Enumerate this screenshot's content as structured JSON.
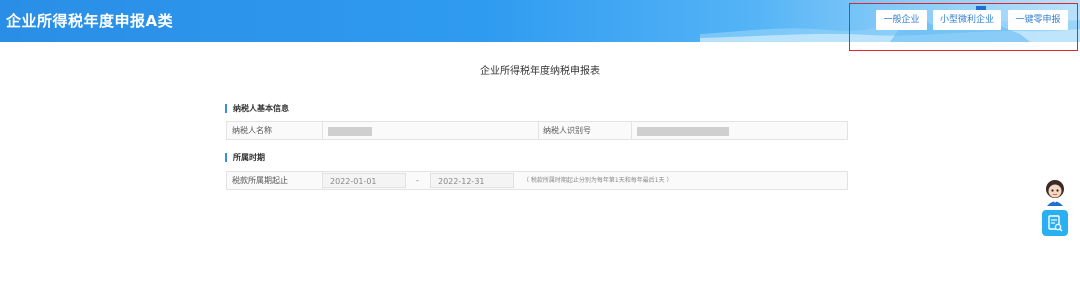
{
  "header": {
    "title": "企业所得税年度申报A类",
    "buttons": [
      {
        "label": "一般企业"
      },
      {
        "label": "小型微利企业"
      },
      {
        "label": "一键零申报"
      }
    ],
    "highlight_color": "#e0262c",
    "gradient_start": "#2a8ee6",
    "gradient_end": "#b9e1fb"
  },
  "form": {
    "title": "企业所得税年度纳税申报表",
    "sections": [
      {
        "title": "纳税人基本信息",
        "fields": [
          {
            "label": "纳税人名称",
            "value_masked": true
          },
          {
            "label": "纳税人识别号",
            "value_masked": true
          }
        ]
      },
      {
        "title": "所属时期",
        "fields": [
          {
            "label": "税款所属期起止",
            "start_date": "2022-01-01",
            "separator": "-",
            "end_date": "2022-12-31",
            "hint": "（ 税款所属时期起止分别为每年第1天和每年最后1天 ）"
          }
        ]
      }
    ]
  },
  "floating": {
    "avatar_icon": "assistant-avatar-icon",
    "side_button_icon": "search-document-icon",
    "side_button_color": "#2ab0f0"
  }
}
